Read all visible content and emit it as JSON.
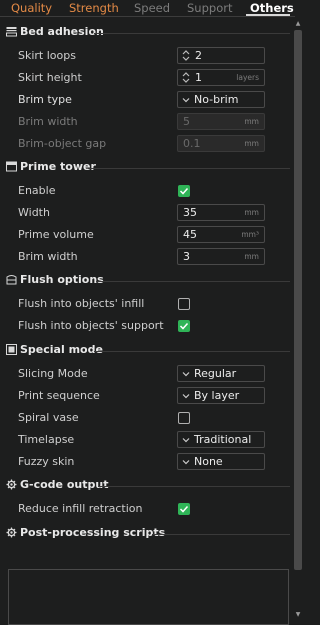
{
  "tabs": [
    {
      "label": "Quality"
    },
    {
      "label": "Strength"
    },
    {
      "label": "Speed"
    },
    {
      "label": "Support"
    },
    {
      "label": "Others"
    }
  ],
  "sections": {
    "bed_adhesion": {
      "title": "Bed adhesion"
    },
    "prime_tower": {
      "title": "Prime tower"
    },
    "flush_options": {
      "title": "Flush options"
    },
    "special_mode": {
      "title": "Special mode"
    },
    "gcode_output": {
      "title": "G-code output"
    },
    "post_processing": {
      "title": "Post-processing scripts"
    }
  },
  "fields": {
    "skirt_loops": {
      "label": "Skirt loops",
      "value": "2"
    },
    "skirt_height": {
      "label": "Skirt height",
      "value": "1",
      "unit": "layers"
    },
    "brim_type": {
      "label": "Brim type",
      "value": "No-brim"
    },
    "brim_width": {
      "label": "Brim width",
      "value": "5",
      "unit": "mm"
    },
    "brim_object_gap": {
      "label": "Brim-object gap",
      "value": "0.1",
      "unit": "mm"
    },
    "enable": {
      "label": "Enable",
      "checked": true
    },
    "width": {
      "label": "Width",
      "value": "35",
      "unit": "mm"
    },
    "prime_volume": {
      "label": "Prime volume",
      "value": "45",
      "unit": "mm³"
    },
    "pt_brim_width": {
      "label": "Brim width",
      "value": "3",
      "unit": "mm"
    },
    "flush_infill": {
      "label": "Flush into objects' infill",
      "checked": false
    },
    "flush_support": {
      "label": "Flush into objects' support",
      "checked": true
    },
    "slicing_mode": {
      "label": "Slicing Mode",
      "value": "Regular"
    },
    "print_sequence": {
      "label": "Print sequence",
      "value": "By layer"
    },
    "spiral_vase": {
      "label": "Spiral vase",
      "checked": false
    },
    "timelapse": {
      "label": "Timelapse",
      "value": "Traditional"
    },
    "fuzzy_skin": {
      "label": "Fuzzy skin",
      "value": "None"
    },
    "reduce_infill_retraction": {
      "label": "Reduce infill retraction",
      "checked": true
    }
  },
  "colors": {
    "accent_orange": "#e38a46",
    "check_green": "#2fb457",
    "background": "#1d1e1e"
  }
}
